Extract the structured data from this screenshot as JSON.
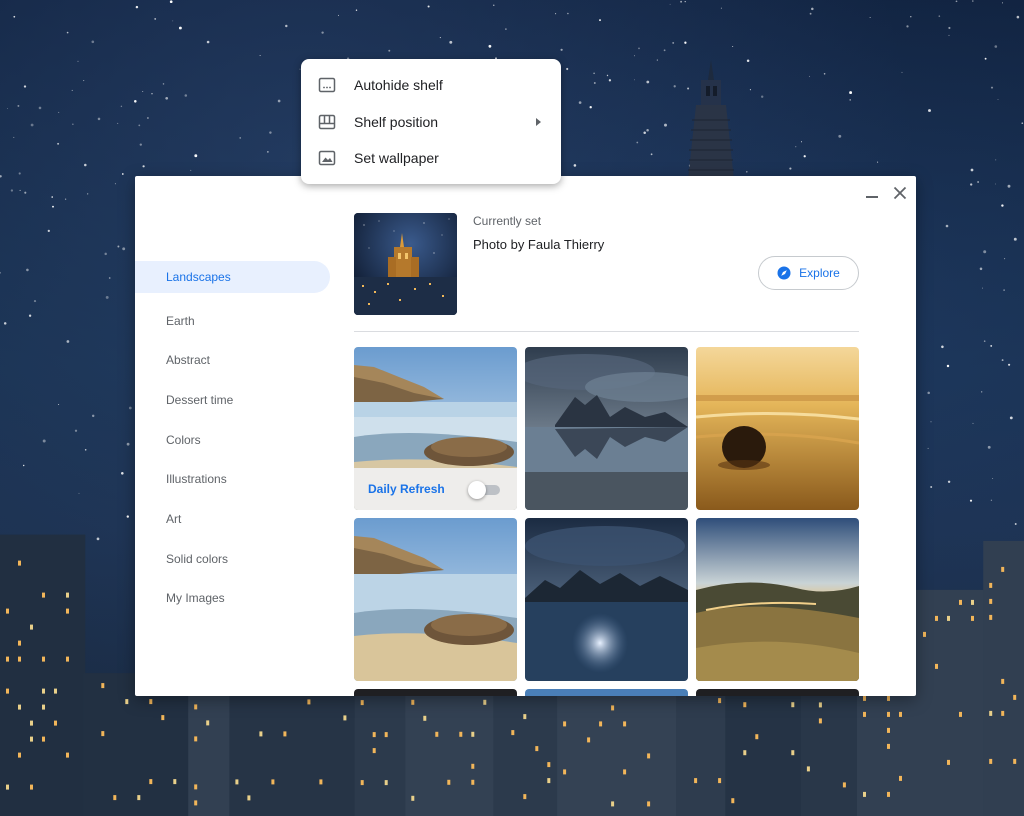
{
  "context_menu": {
    "items": [
      {
        "label": "Autohide shelf",
        "icon": "autohide-shelf-icon"
      },
      {
        "label": "Shelf position",
        "icon": "shelf-position-icon",
        "has_submenu": true
      },
      {
        "label": "Set wallpaper",
        "icon": "wallpaper-icon"
      }
    ]
  },
  "window": {
    "minimize_icon": "minimize-icon",
    "close_icon": "close-icon"
  },
  "sidebar": {
    "items": [
      {
        "label": "Landscapes",
        "active": true
      },
      {
        "label": "Earth"
      },
      {
        "label": "Abstract"
      },
      {
        "label": "Dessert time"
      },
      {
        "label": "Colors"
      },
      {
        "label": "Illustrations"
      },
      {
        "label": "Art"
      },
      {
        "label": "Solid colors"
      },
      {
        "label": "My Images"
      }
    ]
  },
  "current": {
    "label": "Currently set",
    "credit": "Photo by Faula Thierry"
  },
  "explore": {
    "label": "Explore",
    "icon": "compass-icon"
  },
  "daily_refresh": {
    "label": "Daily Refresh",
    "enabled": false
  },
  "colors": {
    "accent": "#1a73e8",
    "active_bg": "#e8f0fe",
    "text_primary": "#202124",
    "text_secondary": "#5f6368"
  }
}
